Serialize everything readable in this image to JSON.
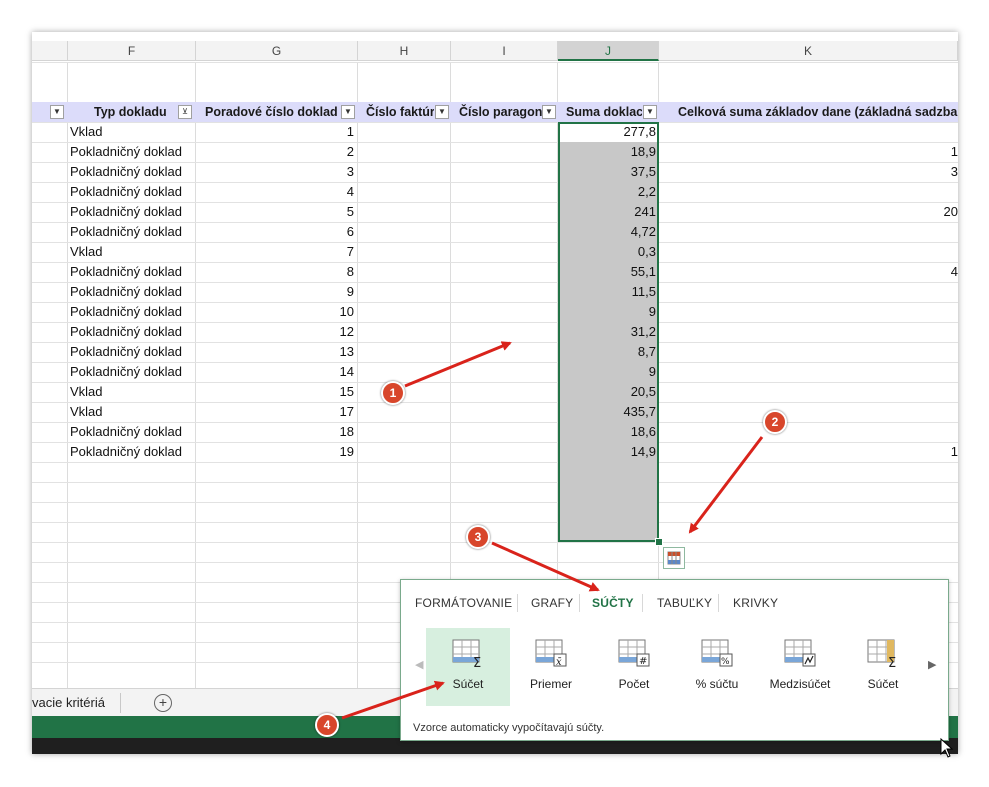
{
  "columns": [
    "F",
    "G",
    "H",
    "I",
    "J",
    "K"
  ],
  "selected_column": "J",
  "table_headers": {
    "typ": "Typ dokladu",
    "poradove": "Poradové číslo doklad",
    "faktury": "Číslo faktúr",
    "paragon": "Číslo paragon",
    "suma": "Suma doklac",
    "celkova": "Celková suma základov dane (základná sadzba"
  },
  "rows": [
    {
      "typ": "Vklad",
      "num": "1",
      "suma": "277,8",
      "k": ""
    },
    {
      "typ": "Pokladničný doklad",
      "num": "2",
      "suma": "18,9",
      "k": "1"
    },
    {
      "typ": "Pokladničný doklad",
      "num": "3",
      "suma": "37,5",
      "k": "3"
    },
    {
      "typ": "Pokladničný doklad",
      "num": "4",
      "suma": "2,2",
      "k": ""
    },
    {
      "typ": "Pokladničný doklad",
      "num": "5",
      "suma": "241",
      "k": "20"
    },
    {
      "typ": "Pokladničný doklad",
      "num": "6",
      "suma": "4,72",
      "k": ""
    },
    {
      "typ": "Vklad",
      "num": "7",
      "suma": "0,3",
      "k": ""
    },
    {
      "typ": "Pokladničný doklad",
      "num": "8",
      "suma": "55,1",
      "k": "4"
    },
    {
      "typ": "Pokladničný doklad",
      "num": "9",
      "suma": "11,5",
      "k": ""
    },
    {
      "typ": "Pokladničný doklad",
      "num": "10",
      "suma": "9",
      "k": ""
    },
    {
      "typ": "Pokladničný doklad",
      "num": "12",
      "suma": "31,2",
      "k": ""
    },
    {
      "typ": "Pokladničný doklad",
      "num": "13",
      "suma": "8,7",
      "k": ""
    },
    {
      "typ": "Pokladničný doklad",
      "num": "14",
      "suma": "9",
      "k": ""
    },
    {
      "typ": "Vklad",
      "num": "15",
      "suma": "20,5",
      "k": ""
    },
    {
      "typ": "Vklad",
      "num": "17",
      "suma": "435,7",
      "k": ""
    },
    {
      "typ": "Pokladničný doklad",
      "num": "18",
      "suma": "18,6",
      "k": ""
    },
    {
      "typ": "Pokladničný doklad",
      "num": "19",
      "suma": "14,9",
      "k": "1"
    }
  ],
  "sheet_tab": "vacie kritériá",
  "add_sheet_icon": "plus-circle-icon",
  "quick_analysis": {
    "tabs": [
      "FORMÁTOVANIE",
      "GRAFY",
      "SÚČTY",
      "TABUĽKY",
      "KRIVKY"
    ],
    "active_tab": "SÚČTY",
    "items": [
      {
        "label": "Súčet",
        "icon": "sum-icon"
      },
      {
        "label": "Priemer",
        "icon": "average-icon"
      },
      {
        "label": "Počet",
        "icon": "count-icon"
      },
      {
        "label": "% súčtu",
        "icon": "percent-icon"
      },
      {
        "label": "Medzisúčet",
        "icon": "running-total-icon"
      },
      {
        "label": "Súčet",
        "icon": "sum-column-icon"
      }
    ],
    "description": "Vzorce automaticky vypočítavajú súčty."
  },
  "callouts": [
    "1",
    "2",
    "3",
    "4"
  ],
  "colors": {
    "excel_green": "#217346",
    "header_fill": "#dcdcfa",
    "badge_red": "#d8462b",
    "arrow_red": "#d9231b"
  }
}
